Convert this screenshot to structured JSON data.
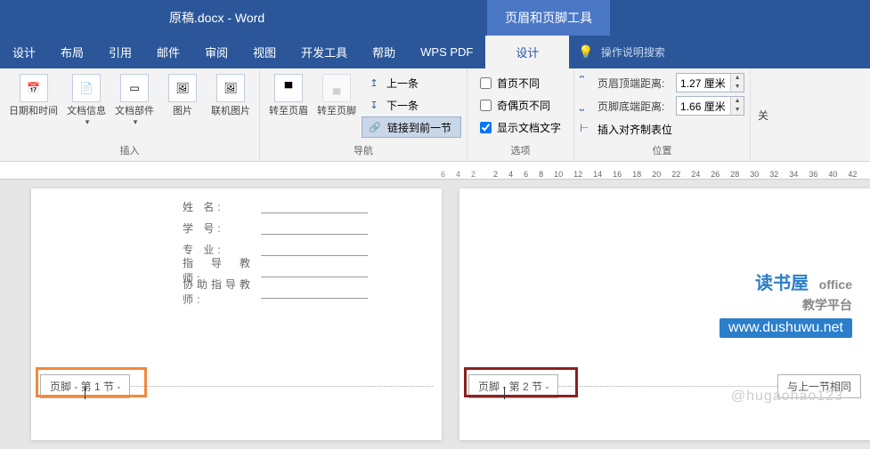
{
  "title": {
    "doc": "原稿.docx",
    "sep": "  -  ",
    "app": "Word",
    "toolTab": "页眉和页脚工具"
  },
  "tabs": {
    "items": [
      "设计",
      "布局",
      "引用",
      "邮件",
      "审阅",
      "视图",
      "开发工具",
      "帮助",
      "WPS PDF",
      "设计"
    ],
    "activeIndex": 9,
    "search": "操作说明搜索"
  },
  "ribbon": {
    "insert": {
      "label": "插入",
      "dateTime": "日期和时间",
      "docInfo": "文档信息",
      "docParts": "文档部件",
      "picture": "图片",
      "onlinePic": "联机图片"
    },
    "nav": {
      "label": "导航",
      "gotoHeader": "转至页眉",
      "gotoFooter": "转至页脚",
      "prev": "上一条",
      "next": "下一条",
      "linkPrev": "链接到前一节"
    },
    "options": {
      "label": "选项",
      "diffFirst": "首页不同",
      "diffOddEven": "奇偶页不同",
      "showDocText": "显示文档文字"
    },
    "position": {
      "label": "位置",
      "headerTop": "页眉顶端距离:",
      "footerBottom": "页脚底端距离:",
      "headerVal": "1.27 厘米",
      "footerVal": "1.66 厘米",
      "insertTab": "插入对齐制表位"
    },
    "close": {
      "label": "关"
    }
  },
  "ruler": {
    "left": [
      "6",
      "4",
      "2"
    ],
    "right": [
      "2",
      "4",
      "6",
      "8",
      "10",
      "12",
      "14",
      "16",
      "18",
      "20",
      "22",
      "24",
      "26",
      "28",
      "30",
      "32",
      "34",
      "36",
      "40",
      "42"
    ]
  },
  "pages": {
    "left": {
      "form": [
        "姓        名:",
        "学        号:",
        "专        业:",
        "指 导 教 师:",
        "协助指导教师:"
      ],
      "footerTag": "页脚 - 第 1 节 -"
    },
    "right": {
      "footerTag": "页脚 - 第 2 节 -",
      "sameAsPrev": "与上一节相同"
    }
  },
  "watermark": {
    "line1a": "读书屋",
    "line1b": "office",
    "line1c": "教学平台",
    "line2": "www.dushuwu.net",
    "author": "@hugaohao123"
  }
}
